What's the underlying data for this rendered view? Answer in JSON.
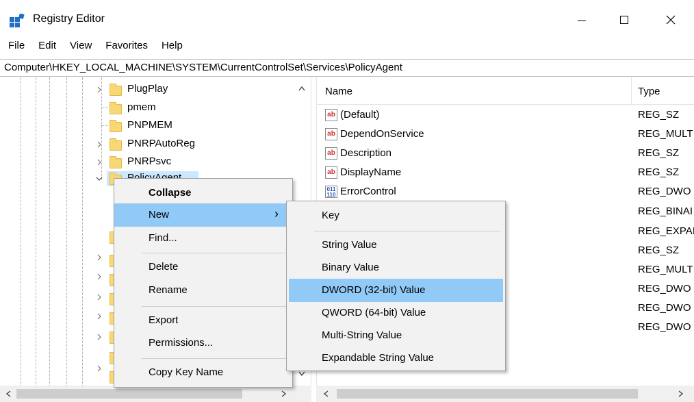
{
  "window": {
    "title": "Registry Editor",
    "controls": {
      "minimize": "—",
      "maximize": "☐",
      "close": "✕"
    }
  },
  "menubar": {
    "items": [
      "File",
      "Edit",
      "View",
      "Favorites",
      "Help"
    ]
  },
  "address": {
    "path": "Computer\\HKEY_LOCAL_MACHINE\\SYSTEM\\CurrentControlSet\\Services\\PolicyAgent"
  },
  "tree": {
    "items": [
      {
        "label": "PlugPlay"
      },
      {
        "label": "pmem"
      },
      {
        "label": "PNPMEM"
      },
      {
        "label": "PNRPAutoReg"
      },
      {
        "label": "PNRPsvc"
      },
      {
        "label": "PolicyAgent"
      }
    ]
  },
  "list": {
    "columns": {
      "name": "Name",
      "type": "Type"
    },
    "rows": [
      {
        "name": "(Default)",
        "type": "REG_SZ",
        "icon": "string-value-icon"
      },
      {
        "name": "DependOnService",
        "type": "REG_MULT",
        "icon": "string-value-icon"
      },
      {
        "name": "Description",
        "type": "REG_SZ",
        "icon": "string-value-icon"
      },
      {
        "name": "DisplayName",
        "type": "REG_SZ",
        "icon": "string-value-icon"
      },
      {
        "name": "ErrorControl",
        "type": "REG_DWO",
        "icon": "binary-value-icon"
      },
      {
        "name": "",
        "type": "REG_BINAI",
        "icon": ""
      },
      {
        "name": "",
        "type": "REG_EXPAI",
        "icon": ""
      },
      {
        "name": "",
        "type": "REG_SZ",
        "icon": ""
      },
      {
        "name": "",
        "type": "REG_MULT",
        "icon": ""
      },
      {
        "name": "",
        "type": "REG_DWO",
        "icon": ""
      },
      {
        "name": "",
        "type": "REG_DWO",
        "icon": ""
      },
      {
        "name": "",
        "type": "REG_DWO",
        "icon": ""
      }
    ]
  },
  "context_menu": {
    "items": [
      "Collapse",
      "New",
      "Find...",
      "Delete",
      "Rename",
      "Export",
      "Permissions...",
      "Copy Key Name"
    ],
    "submenu_arrow": "›",
    "highlighted": "New"
  },
  "submenu": {
    "items": [
      "Key",
      "String Value",
      "Binary Value",
      "DWORD (32-bit) Value",
      "QWORD (64-bit) Value",
      "Multi-String Value",
      "Expandable String Value"
    ],
    "highlighted": "DWORD (32-bit) Value"
  },
  "icons": {
    "string": "ab",
    "binary": "011\n110"
  },
  "colors": {
    "menu_highlight": "#91c9f7",
    "tree_selection": "#cce8ff",
    "folder": "#f8d775"
  }
}
